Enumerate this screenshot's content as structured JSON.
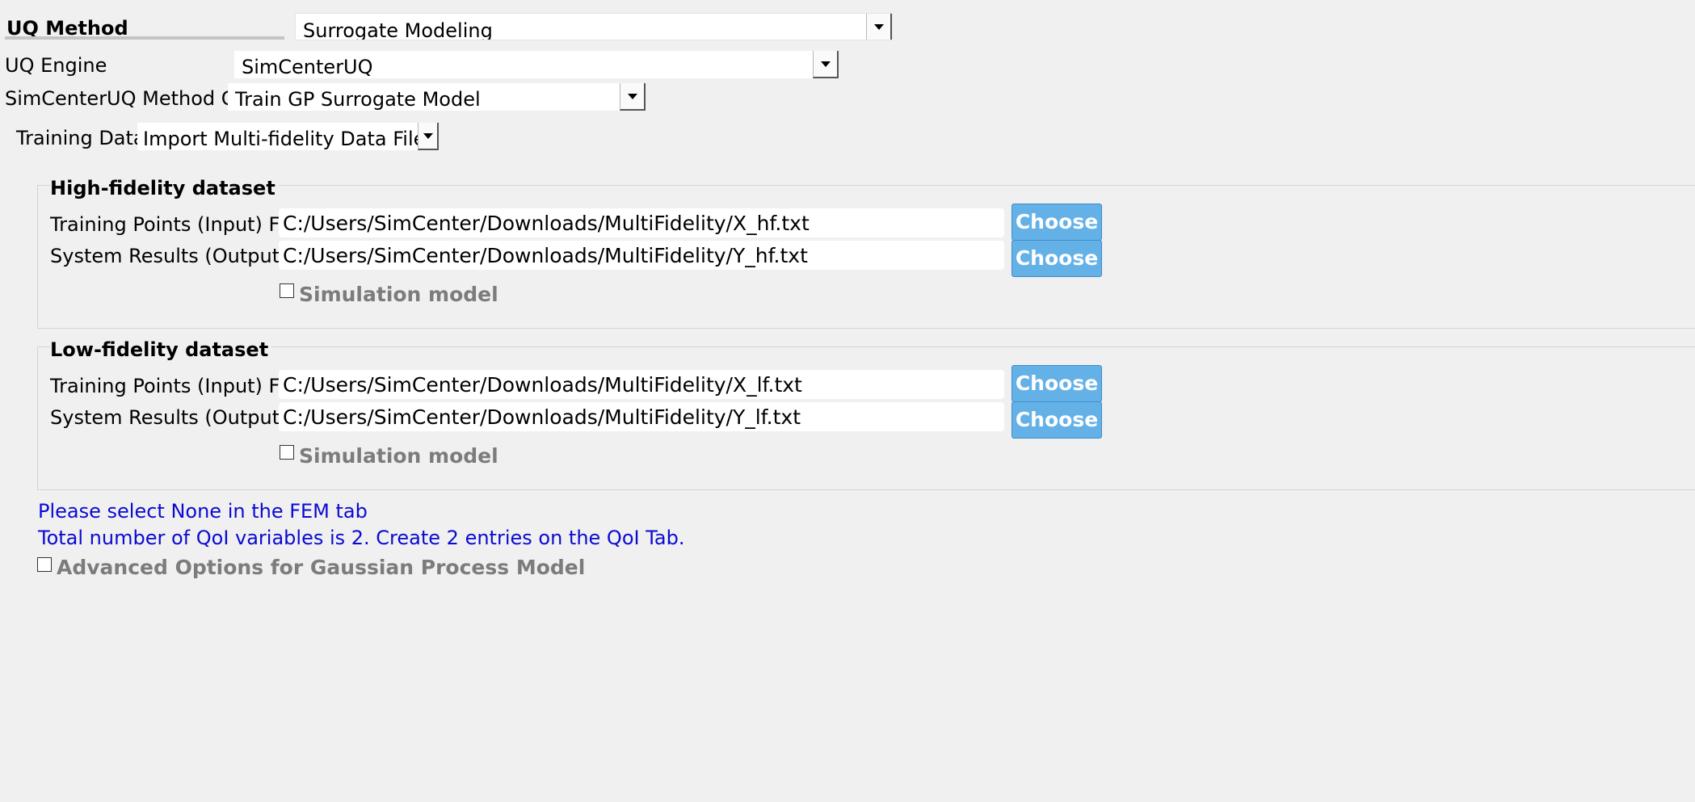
{
  "uq_method": {
    "heading": "UQ Method",
    "selected": "Surrogate Modeling"
  },
  "uq_engine": {
    "label": "UQ Engine",
    "selected": "SimCenterUQ"
  },
  "method_category": {
    "label": "SimCenterUQ Method Category",
    "selected": "Train GP Surrogate Model"
  },
  "training_dataset": {
    "label": "Training Dataset",
    "selected": "Import Multi-fidelity Data File"
  },
  "high_fidelity": {
    "title": "High-fidelity dataset",
    "input_label": "Training Points (Input) File",
    "input_value": "C:/Users/SimCenter/Downloads/MultiFidelity/X_hf.txt",
    "output_label": "System Results (Output) File",
    "output_value": "C:/Users/SimCenter/Downloads/MultiFidelity/Y_hf.txt",
    "choose_label": "Choose",
    "simulation_label": "Simulation model"
  },
  "low_fidelity": {
    "title": "Low-fidelity dataset",
    "input_label": "Training Points (Input) File",
    "input_value": "C:/Users/SimCenter/Downloads/MultiFidelity/X_lf.txt",
    "output_label": "System Results (Output) File",
    "output_value": "C:/Users/SimCenter/Downloads/MultiFidelity/Y_lf.txt",
    "choose_label": "Choose",
    "simulation_label": "Simulation model"
  },
  "messages": {
    "fem_note": "Please select None in the FEM tab",
    "qoi_note": "Total number of QoI variables is 2. Create 2 entries on the QoI Tab."
  },
  "advanced": {
    "label": "Advanced Options for Gaussian Process Model"
  },
  "colors": {
    "background": "#f0f0f0",
    "button_blue": "#64b1e8",
    "info_blue": "#0a0ad2",
    "disabled_gray": "#7c7c7c"
  }
}
